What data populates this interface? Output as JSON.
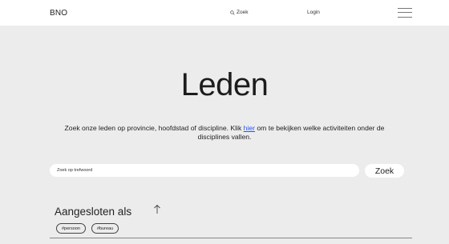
{
  "header": {
    "logo": "BNO",
    "search_label": "Zoek",
    "login_label": "Login",
    "search_icon": "search-icon",
    "menu_icon": "hamburger-menu-icon"
  },
  "main": {
    "title": "Leden",
    "intro_before": "Zoek onze leden op provincie, hoofdstad of discipline. Klik ",
    "intro_link": "hier",
    "intro_after": " om te bekijken welke activiteiten onder de disciplines vallen.",
    "search": {
      "placeholder": "Zoek op trefwoord",
      "button_label": "Zoek"
    },
    "filter": {
      "title": "Aangesloten als",
      "sort_icon": "arrow-up-icon",
      "tags": [
        "#persoon",
        "#bureau"
      ]
    }
  },
  "colors": {
    "background": "#ececec",
    "header_background": "#ffffff",
    "link": "#2454ff"
  }
}
